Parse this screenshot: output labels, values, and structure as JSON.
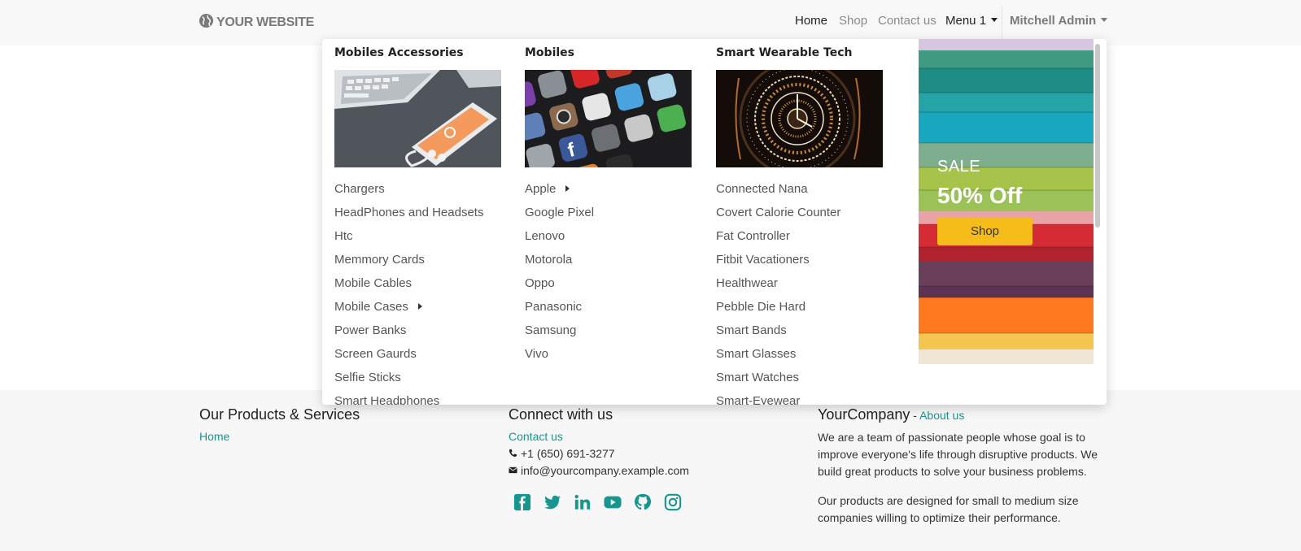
{
  "navbar": {
    "logo_text": "YOUR WEBSITE",
    "links": [
      "Home",
      "Shop",
      "Contact us"
    ],
    "menu1": "Menu 1",
    "user": "Mitchell Admin"
  },
  "megamenu": {
    "columns": [
      {
        "title": "Mobiles Accessories",
        "items": [
          "Chargers",
          "HeadPhones and Headsets",
          "Htc",
          "Memmory Cards",
          "Mobile Cables",
          "Mobile Cases",
          "Power Banks",
          "Screen Gaurds",
          "Selfie Sticks",
          "Smart Headphones"
        ]
      },
      {
        "title": "Mobiles",
        "items": [
          "Apple",
          "Google Pixel",
          "Lenovo",
          "Motorola",
          "Oppo",
          "Panasonic",
          "Samsung",
          "Vivo"
        ]
      },
      {
        "title": "Smart Wearable Tech",
        "items": [
          "Connected Nana",
          "Covert Calorie Counter",
          "Fat Controller",
          "Fitbit Vacationers",
          "Healthwear",
          "Pebble Die Hard",
          "Smart Bands",
          "Smart Glasses",
          "Smart Watches",
          "Smart-Eyewear"
        ]
      }
    ],
    "promo": {
      "sale": "SALE",
      "off": "50% Off",
      "button": "Shop"
    }
  },
  "footer": {
    "products": {
      "title": "Our Products & Services",
      "home": "Home"
    },
    "connect": {
      "title": "Connect with us",
      "contact": "Contact us",
      "phone": "+1 (650) 691-3277",
      "email": "info@yourcompany.example.com"
    },
    "company": {
      "name": "YourCompany",
      "dash": " - ",
      "about": "About us",
      "p1": "We are a team of passionate people whose goal is to improve everyone's life through disruptive products. We build great products to solve your business problems.",
      "p2": "Our products are designed for small to medium size companies willing to optimize their performance."
    }
  },
  "colors": {
    "accent": "#17968f",
    "sale_button": "#f6bc1a"
  }
}
